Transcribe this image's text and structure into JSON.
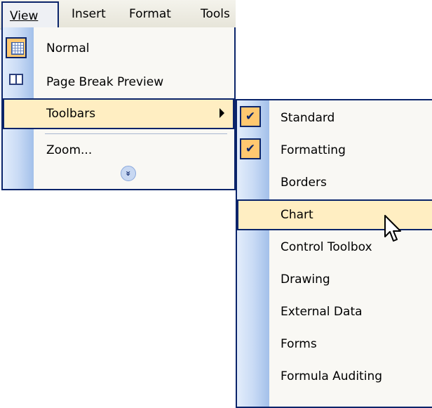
{
  "menubar": {
    "view": "View",
    "insert": "Insert",
    "format": "Format",
    "tools": "Tools"
  },
  "view_menu": {
    "normal": "Normal",
    "page_break_preview": "Page Break Preview",
    "toolbars": "Toolbars",
    "zoom": "Zoom...",
    "expand": "»"
  },
  "toolbars_menu": {
    "items": [
      {
        "label": "Standard",
        "checked": true
      },
      {
        "label": "Formatting",
        "checked": true
      },
      {
        "label": "Borders",
        "checked": false
      },
      {
        "label": "Chart",
        "checked": false,
        "highlighted": true
      },
      {
        "label": "Control Toolbox",
        "checked": false
      },
      {
        "label": "Drawing",
        "checked": false
      },
      {
        "label": "External Data",
        "checked": false
      },
      {
        "label": "Forms",
        "checked": false
      },
      {
        "label": "Formula Auditing",
        "checked": false
      }
    ],
    "check_glyph": "✔"
  },
  "colors": {
    "highlight_bg": "#ffeec2",
    "highlight_border": "#0a246a",
    "icon_bg": "#ffc870",
    "gutter": "#c9dbf5"
  }
}
